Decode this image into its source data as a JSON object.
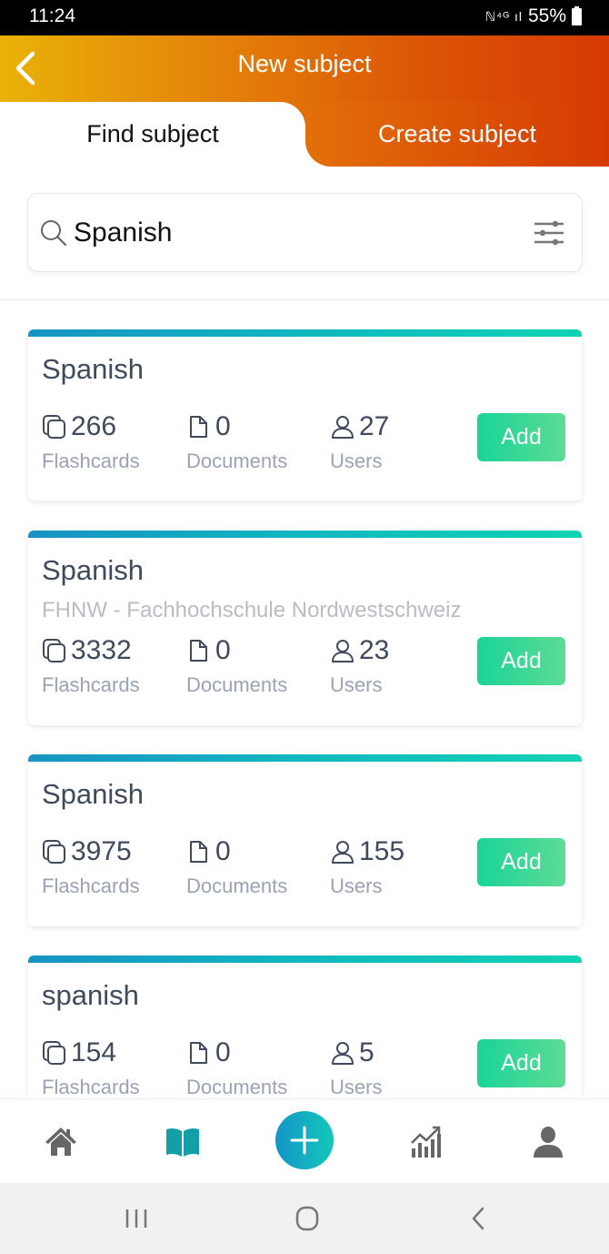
{
  "status_bar": {
    "time": "11:24",
    "signal_icons": "mute-vibrate 4G signal",
    "battery": "55%"
  },
  "header": {
    "title": "New subject",
    "back_icon": "chevron-left-icon"
  },
  "tabs": [
    {
      "label": "Find subject",
      "active": true
    },
    {
      "label": "Create subject",
      "active": false
    }
  ],
  "search": {
    "value": "Spanish",
    "placeholder": "",
    "search_icon": "search-icon",
    "filter_icon": "sliders-icon"
  },
  "stat_labels": {
    "flashcards": "Flashcards",
    "documents": "Documents",
    "users": "Users"
  },
  "add_label": "Add",
  "results": [
    {
      "title": "Spanish",
      "subtitle": "",
      "flashcards": "266",
      "documents": "0",
      "users": "27"
    },
    {
      "title": "Spanish",
      "subtitle": "FHNW - Fachhochschule Nordwestschweiz",
      "flashcards": "3332",
      "documents": "0",
      "users": "23"
    },
    {
      "title": "Spanish",
      "subtitle": "",
      "flashcards": "3975",
      "documents": "0",
      "users": "155"
    },
    {
      "title": "spanish",
      "subtitle": "",
      "flashcards": "154",
      "documents": "0",
      "users": "5"
    }
  ],
  "bottom_nav": [
    {
      "name": "home",
      "icon": "home-icon",
      "active": false
    },
    {
      "name": "library",
      "icon": "book-icon",
      "active": true
    },
    {
      "name": "add",
      "icon": "plus-icon",
      "active": false
    },
    {
      "name": "statistics",
      "icon": "chart-icon",
      "active": false
    },
    {
      "name": "profile",
      "icon": "user-icon",
      "active": false
    }
  ],
  "colors": {
    "header_gradient_start": "#e9b208",
    "header_gradient_end": "#d53a04",
    "card_bar_start": "#1793c3",
    "card_bar_end": "#10d2b4",
    "add_button": "#19d39a",
    "active_nav": "#139fa8",
    "inactive_nav": "#666666"
  }
}
